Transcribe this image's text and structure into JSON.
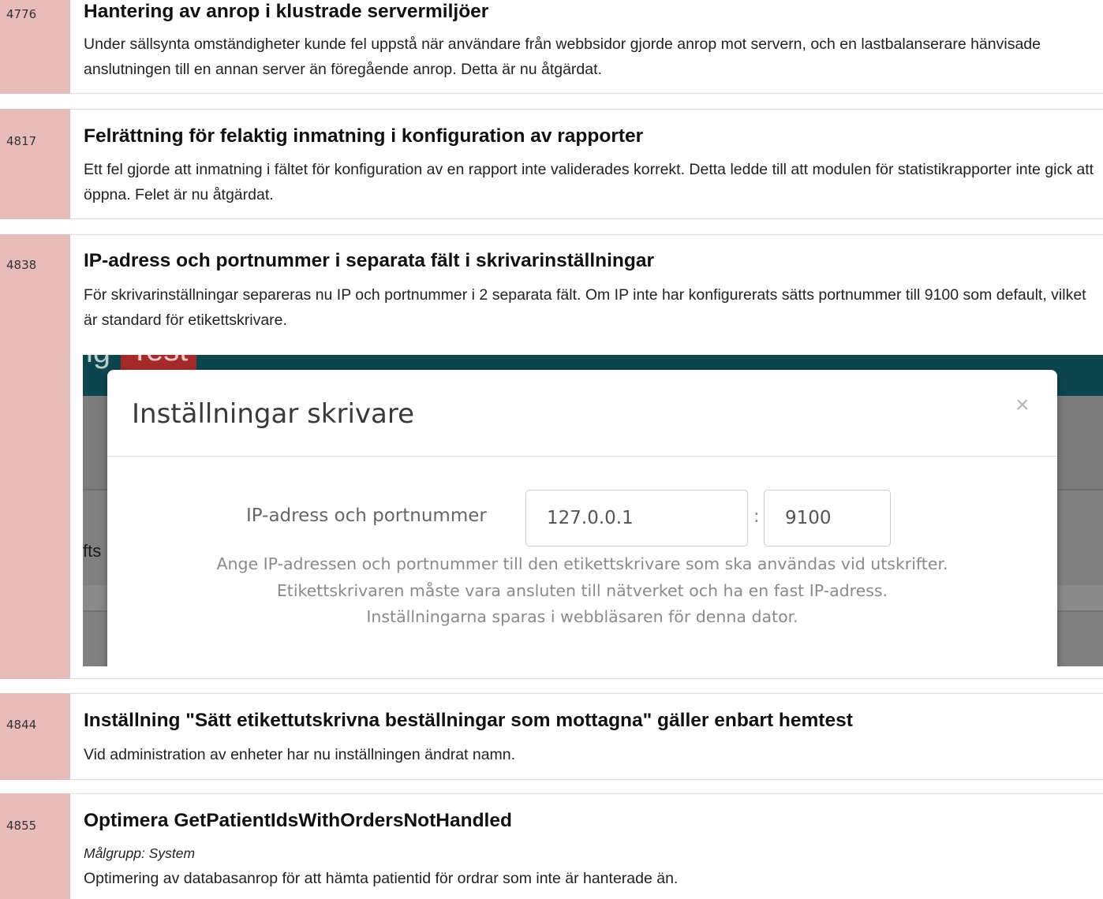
{
  "entries": [
    {
      "id": "4776",
      "title": "Hantering av anrop i klustrade servermiljöer",
      "description": "Under sällsynta omständigheter kunde fel uppstå när användare från webbsidor gjorde anrop mot servern, och en lastbalanserare hänvisade anslutningen till en annan server än föregående anrop. Detta är nu åtgärdat."
    },
    {
      "id": "4817",
      "title": "Felrättning för felaktig inmatning i konfiguration av rapporter",
      "description": "Ett fel gjorde att inmatning i fältet för konfiguration av en rapport inte validerades korrekt. Detta ledde till att modulen för statistikrapporter inte gick att öppna. Felet är nu åtgärdat."
    },
    {
      "id": "4838",
      "title": "IP-adress och portnummer i separata fält i skrivarinställningar",
      "description": "För skrivarinställningar separeras nu IP och portnummer i 2 separata fält. Om IP inte har konfigurerats sätts portnummer till 9100 som default, vilket är standard för etikettskrivare."
    },
    {
      "id": "4844",
      "title": "Inställning \"Sätt etikettutskrivna beställningar som mottagna\" gäller enbart hemtest",
      "description": "Vid administration av enheter har nu inställningen ändrat namn."
    },
    {
      "id": "4855",
      "title": "Optimera GetPatientIdsWithOrdersNotHandled",
      "target_group": "Målgrupp: System",
      "description": "Optimering av databasanrop för att hämta patientid för ordrar som inte är hanterade än."
    }
  ],
  "screenshot": {
    "brand_fragment": "ig",
    "badge_fragment": "Test",
    "side_fragment": "fts",
    "modal": {
      "title": "Inställningar skrivare",
      "close_symbol": "×",
      "field_label": "IP-adress och portnummer",
      "ip_value": "127.0.0.1",
      "separator": ":",
      "port_value": "9100",
      "help_lines": [
        "Ange IP-adressen och portnummer till den etikettskrivare som ska användas vid utskrifter.",
        "Etikettskrivaren måste vara ansluten till nätverket och ha en fast IP-adress.",
        "Inställningarna sparas i webbläsaren för denna dator."
      ]
    }
  },
  "colors": {
    "gutter": "#e9bcbc",
    "app_header": "#0e4650",
    "test_badge": "#a52a2a",
    "overlay": "#808080"
  }
}
